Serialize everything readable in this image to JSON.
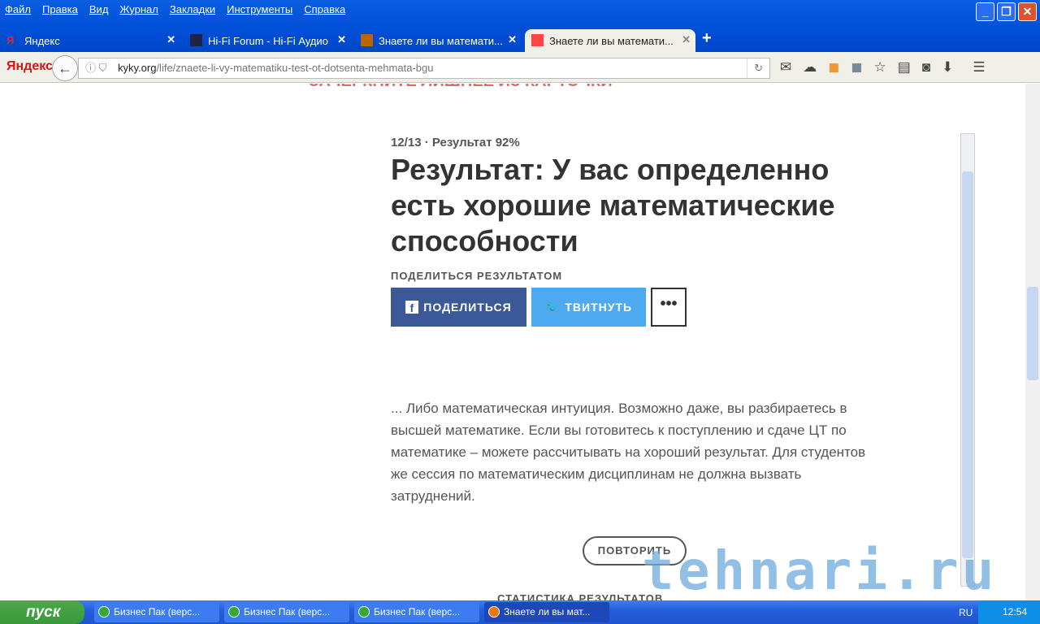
{
  "menu": [
    "Файл",
    "Правка",
    "Вид",
    "Журнал",
    "Закладки",
    "Инструменты",
    "Справка"
  ],
  "tabs": [
    {
      "label": "Яндекс"
    },
    {
      "label": "Hi-Fi Forum - Hi-Fi Аудио"
    },
    {
      "label": "Знаете ли вы математи..."
    },
    {
      "label": "Знаете ли вы математи..."
    }
  ],
  "navbar": {
    "logo": "Яндекс",
    "url_domain": "kyky.org",
    "url_path": "/life/znaete-li-vy-matematiku-test-ot-dotsenta-mehmata-bgu"
  },
  "page": {
    "top_partial": "ЗАЧЕРКНИТЕ ЛИШНЕЕ ИЗ КАРТОЧКИ",
    "meta": "12/13 · Результат 92%",
    "title": "Результат: У вас определенно есть хорошие математические способности",
    "share_label": "ПОДЕЛИТЬСЯ РЕЗУЛЬТАТОМ",
    "fb_button": "ПОДЕЛИТЬСЯ",
    "tw_button": "ТВИТНУТЬ",
    "more_button": "•••",
    "description": "... Либо математическая интуиция. Возможно даже, вы разбираетесь в высшей математике. Если вы готовитесь к поступлению и сдаче ЦТ по математике – можете рассчитывать на хороший результат. Для студентов же сессия по математическим дисциплинам не должна вызвать затруднений.",
    "repeat_button": "ПОВТОРИТЬ",
    "stats_heading": "СТАТИСТИКА РЕЗУЛЬТАТОВ"
  },
  "watermark": "tehnari.ru",
  "taskbar": {
    "start": "пуск",
    "tasks": [
      "Бизнес Пак (верс...",
      "Бизнес Пак (верс...",
      "Бизнес Пак (верс...",
      "Знаете ли вы мат..."
    ],
    "lang": "RU",
    "time": "12:54"
  }
}
